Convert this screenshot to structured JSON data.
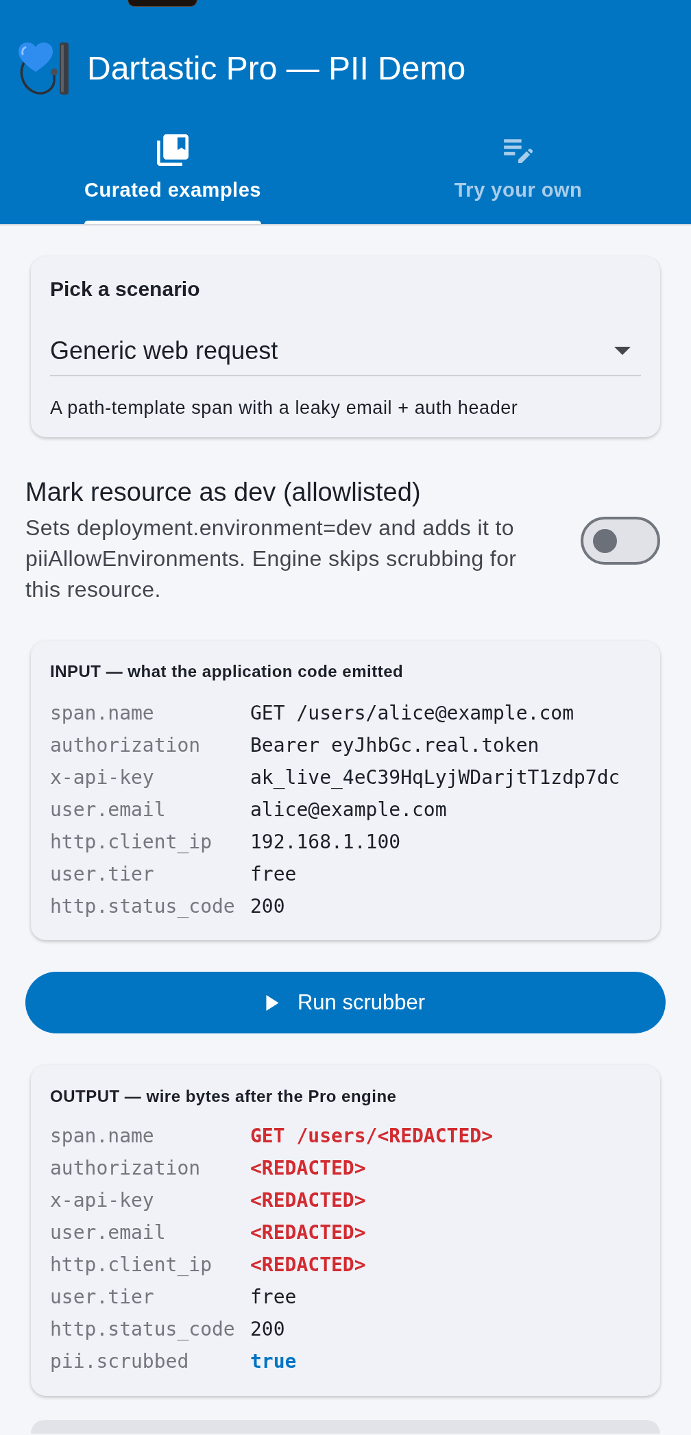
{
  "app_bar": {
    "title": "Dartastic Pro — PII Demo"
  },
  "tabs": [
    {
      "label": "Curated examples",
      "selected": true
    },
    {
      "label": "Try your own",
      "selected": false
    }
  ],
  "scenario_card": {
    "title": "Pick a scenario",
    "dropdown": {
      "value": "Generic web request"
    },
    "helper": "A path-template span with a leaky email + auth header"
  },
  "dev_toggle": {
    "title": "Mark resource as dev (allowlisted)",
    "description": "Sets deployment.environment=dev and adds it to piiAllowEnvironments. Engine skips scrubbing for this resource.",
    "on": false
  },
  "input_card": {
    "title": "INPUT — what the application code emitted",
    "rows": [
      {
        "key": "span.name",
        "value": "GET /users/alice@example.com",
        "kind": "plain"
      },
      {
        "key": "authorization",
        "value": "Bearer eyJhbGc.real.token",
        "kind": "plain"
      },
      {
        "key": "x-api-key",
        "value": "ak_live_4eC39HqLyjWDarjtT1zdp7dc",
        "kind": "plain"
      },
      {
        "key": "user.email",
        "value": "alice@example.com",
        "kind": "plain"
      },
      {
        "key": "http.client_ip",
        "value": "192.168.1.100",
        "kind": "plain"
      },
      {
        "key": "user.tier",
        "value": "free",
        "kind": "plain"
      },
      {
        "key": "http.status_code",
        "value": "200",
        "kind": "plain"
      }
    ]
  },
  "run_button": {
    "label": "Run scrubber"
  },
  "output_card": {
    "title": "OUTPUT — wire bytes after the Pro engine",
    "rows": [
      {
        "key": "span.name",
        "value": "GET /users/<REDACTED>",
        "kind": "redacted"
      },
      {
        "key": "authorization",
        "value": "<REDACTED>",
        "kind": "redacted"
      },
      {
        "key": "x-api-key",
        "value": "<REDACTED>",
        "kind": "redacted"
      },
      {
        "key": "user.email",
        "value": "<REDACTED>",
        "kind": "redacted"
      },
      {
        "key": "http.client_ip",
        "value": "<REDACTED>",
        "kind": "redacted"
      },
      {
        "key": "user.tier",
        "value": "free",
        "kind": "plain"
      },
      {
        "key": "http.status_code",
        "value": "200",
        "kind": "plain"
      },
      {
        "key": "pii.scrubbed",
        "value": "true",
        "kind": "flag"
      }
    ]
  }
}
